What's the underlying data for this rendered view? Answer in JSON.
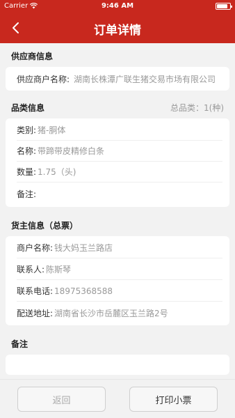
{
  "status_bar": {
    "carrier": "Carrier",
    "time": "9:46 AM",
    "battery_level": 0.85
  },
  "header": {
    "title": "订单详情",
    "back_icon": "chevron-left-icon"
  },
  "supplier": {
    "heading": "供应商信息",
    "label": "供应商户名称:",
    "value": "湖南长株潭广联生猪交易市场有限公司"
  },
  "category": {
    "heading": "品类信息",
    "total": "总品类：1(种)",
    "rows": [
      {
        "label": "类别:",
        "value": "猪-胴体"
      },
      {
        "label": "名称:",
        "value": "带蹄带皮精修白条"
      },
      {
        "label": "数量:",
        "value": "1.75（头)"
      },
      {
        "label": "备注:",
        "value": ""
      }
    ]
  },
  "owner": {
    "heading": "货主信息（总票）",
    "rows": [
      {
        "label": "商户名称:",
        "value": "钱大妈玉兰路店"
      },
      {
        "label": "联系人:",
        "value": "陈斯琴"
      },
      {
        "label": "联系电话:",
        "value": "18975368588"
      },
      {
        "label": "配送地址:",
        "value": "湖南省长沙市岳麓区玉兰路2号"
      }
    ]
  },
  "remark": {
    "heading": "备注",
    "value": ""
  },
  "footer": {
    "back_label": "返回",
    "print_label": "打印小票"
  }
}
